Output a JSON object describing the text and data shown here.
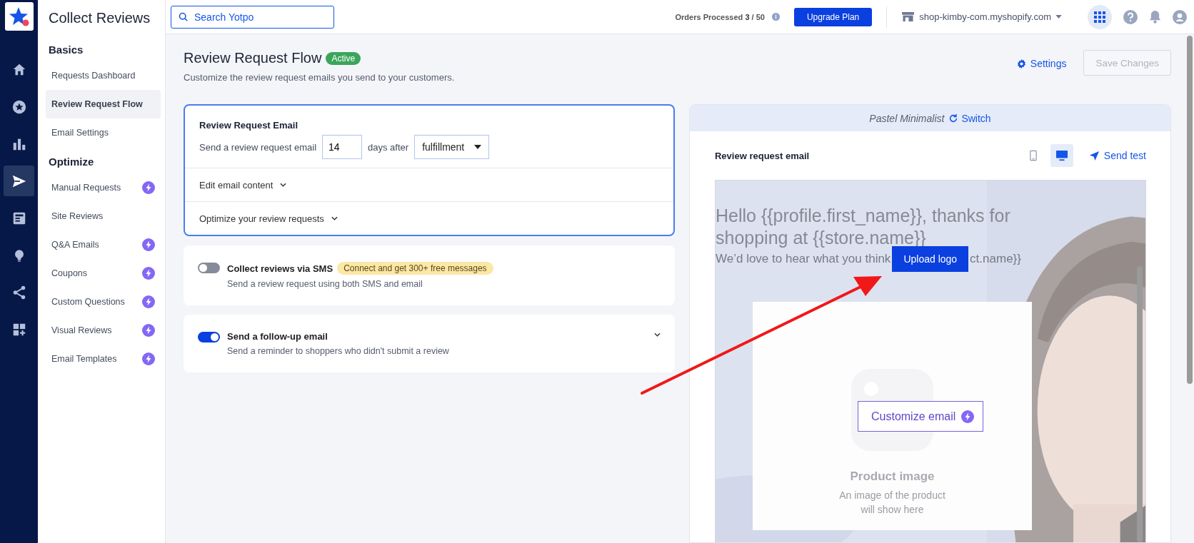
{
  "rail": {
    "items": [
      {
        "selected": false
      },
      {
        "selected": false
      },
      {
        "selected": false
      },
      {
        "selected": true
      },
      {
        "selected": false
      },
      {
        "selected": false
      },
      {
        "selected": false
      },
      {
        "selected": false
      }
    ]
  },
  "sidebar": {
    "title": "Collect Reviews",
    "sections": [
      {
        "heading": "Basics",
        "items": [
          {
            "label": "Requests Dashboard",
            "selected": false,
            "premium": false
          },
          {
            "label": "Review Request Flow",
            "selected": true,
            "premium": false
          },
          {
            "label": "Email Settings",
            "selected": false,
            "premium": false
          }
        ]
      },
      {
        "heading": "Optimize",
        "items": [
          {
            "label": "Manual Requests",
            "selected": false,
            "premium": true
          },
          {
            "label": "Site Reviews",
            "selected": false,
            "premium": false
          },
          {
            "label": "Q&A Emails",
            "selected": false,
            "premium": true
          },
          {
            "label": "Coupons",
            "selected": false,
            "premium": true
          },
          {
            "label": "Custom Questions",
            "selected": false,
            "premium": true
          },
          {
            "label": "Visual Reviews",
            "selected": false,
            "premium": true
          },
          {
            "label": "Email Templates",
            "selected": false,
            "premium": true
          }
        ]
      }
    ]
  },
  "topbar": {
    "search": {
      "placeholder": "Search Yotpo"
    },
    "orders_label": "Orders Processed",
    "orders_used": "3",
    "orders_total": "/ 50",
    "upgrade_button": "Upgrade Plan",
    "store": "shop-kimby-com.myshopify.com"
  },
  "page": {
    "title": "Review Request Flow",
    "status": "Active",
    "subtitle": "Customize the review request emails you send to your customers.",
    "settings_link": "Settings",
    "save_button": {
      "label": "Save Changes",
      "disabled": true
    }
  },
  "email_card": {
    "title": "Review Request Email",
    "prefix": "Send a review request email",
    "days": "14",
    "middle": "days after",
    "trigger": "fulfillment",
    "sections": [
      {
        "label": "Edit email content",
        "expanded": false
      },
      {
        "label": "Optimize your review requests",
        "expanded": false
      }
    ]
  },
  "options": [
    {
      "title": "Collect reviews via SMS",
      "badge": "Connect and get 300+ free messages",
      "description": "Send a review request using both SMS and email",
      "on": false,
      "expandable": false
    },
    {
      "title": "Send a follow-up email",
      "description": "Send a reminder to shoppers who didn't submit a review",
      "on": true,
      "expandable": true
    }
  ],
  "preview": {
    "template": "Pastel Minimalist",
    "switch_link": "Switch",
    "title": "Review request email",
    "devices": [
      {
        "selected": false
      },
      {
        "selected": true
      }
    ],
    "send_test": "Send test",
    "email": {
      "kind": "picture",
      "greeting": "Hello {{profile.first_name}}, thanks for shopping at {{store.name}}",
      "intro_left": "We’d love to hear what you think",
      "intro_right": "ct.name}}",
      "upload_button": "Upload logo",
      "product_title": "Product image",
      "product_text": "An image of the product will show here",
      "customize_button": "Customize email"
    }
  }
}
